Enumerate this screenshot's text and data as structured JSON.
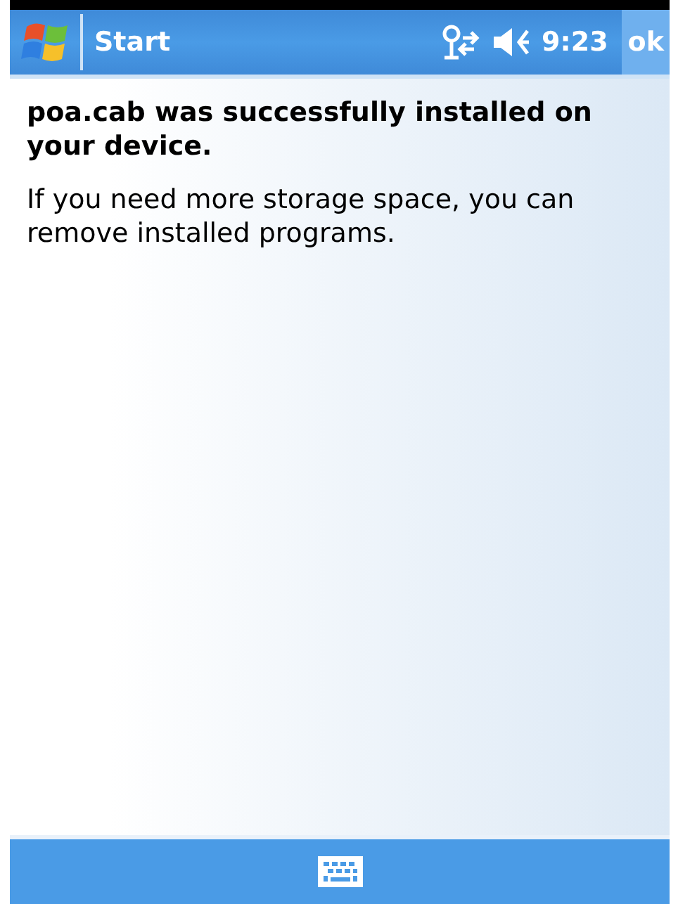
{
  "title_bar": {
    "title": "Start",
    "time": "9:23",
    "ok_label": "ok"
  },
  "message": {
    "heading": "poa.cab was successfully installed on your device.",
    "body": "If you need more storage space, you can remove installed programs."
  }
}
